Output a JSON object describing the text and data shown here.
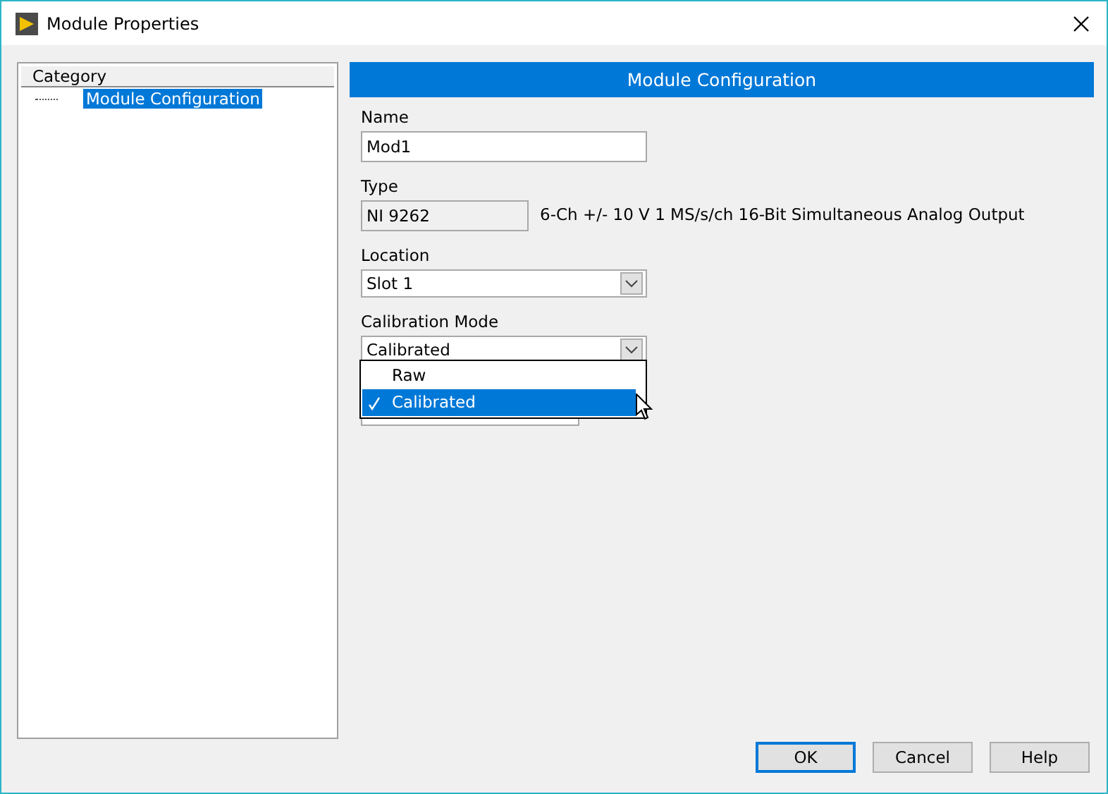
{
  "window": {
    "title": "Module Properties"
  },
  "category": {
    "header": "Category",
    "items": [
      {
        "label": "Module Configuration",
        "selected": true
      }
    ]
  },
  "section_title": "Module Configuration",
  "name": {
    "label": "Name",
    "value": "Mod1"
  },
  "type": {
    "label": "Type",
    "value": "NI 9262",
    "description": "6-Ch +/- 10 V 1 MS/s/ch 16-Bit Simultaneous Analog Output"
  },
  "location": {
    "label": "Location",
    "value": "Slot 1"
  },
  "calibration_mode": {
    "label": "Calibration Mode",
    "value": "Calibrated",
    "expanded": true,
    "options": [
      {
        "label": "Raw",
        "selected": false
      },
      {
        "label": "Calibrated",
        "selected": true
      }
    ]
  },
  "buttons": [
    {
      "label": "OK",
      "default": true
    },
    {
      "label": "Cancel",
      "default": false
    },
    {
      "label": "Help",
      "default": false
    }
  ]
}
